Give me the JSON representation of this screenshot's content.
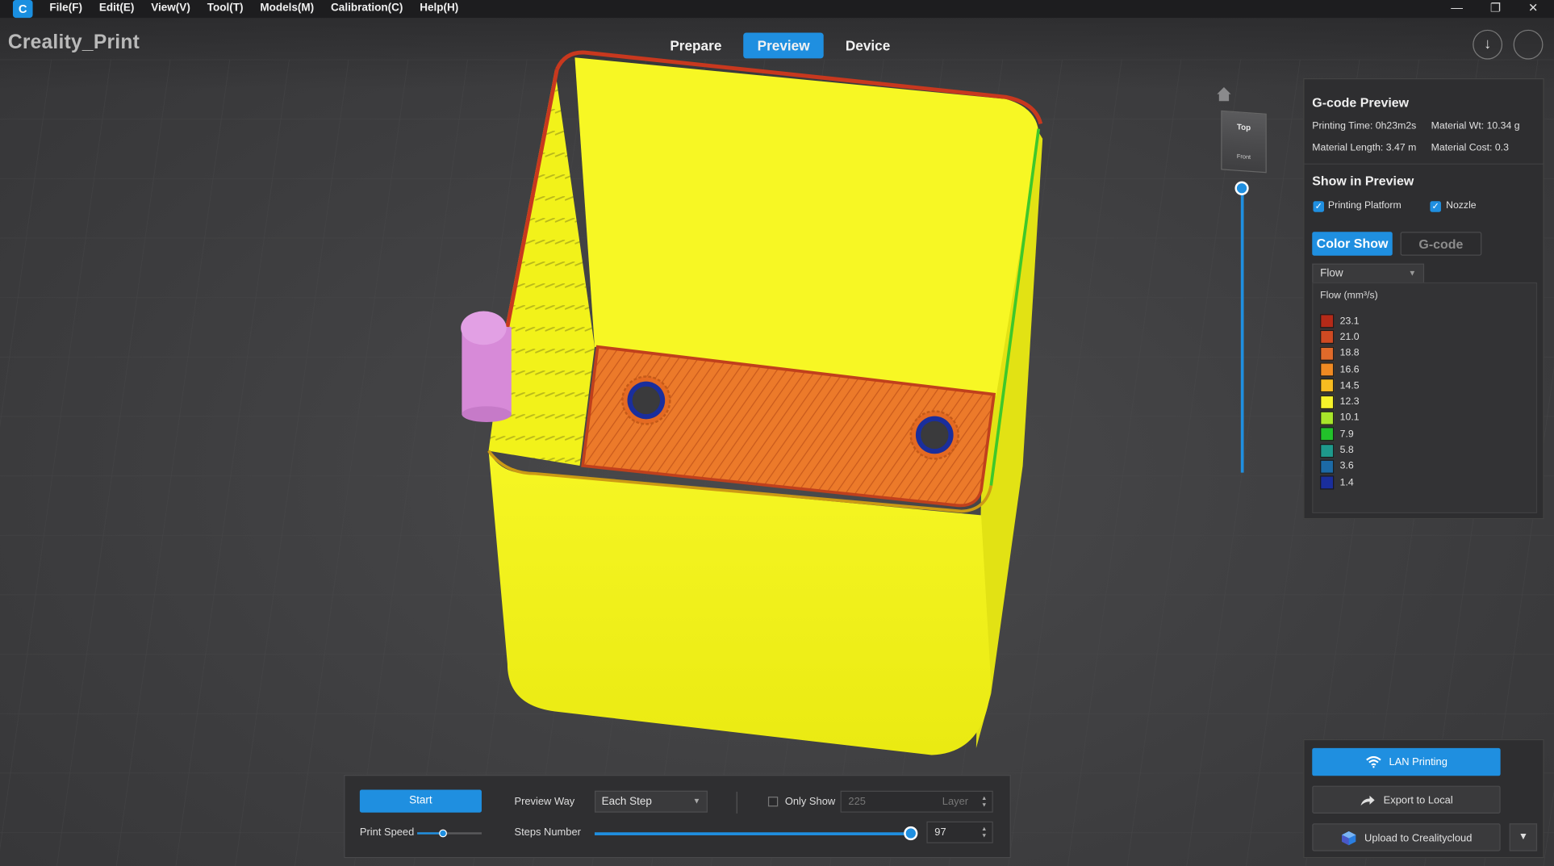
{
  "window": {
    "app_title": "Creality_Print",
    "controls": {
      "minimize": "—",
      "restore": "❐",
      "close": "✕"
    }
  },
  "menu": [
    "File(F)",
    "Edit(E)",
    "View(V)",
    "Tool(T)",
    "Models(M)",
    "Calibration(C)",
    "Help(H)"
  ],
  "top_tabs": [
    {
      "label": "Prepare",
      "active": false
    },
    {
      "label": "Preview",
      "active": true
    },
    {
      "label": "Device",
      "active": false
    }
  ],
  "view_cube": {
    "top": "Top",
    "front": "Front"
  },
  "gcode_panel": {
    "title": "G-code Preview",
    "printing_time": "Printing Time: 0h23m2s",
    "material_wt": "Material Wt: 10.34 g",
    "material_length": "Material Length: 3.47 m",
    "material_cost": "Material Cost: 0.3",
    "show_title": "Show in Preview",
    "printing_platform": "Printing Platform",
    "nozzle": "Nozzle",
    "color_show": "Color Show",
    "gcode": "G-code",
    "select_value": "Flow",
    "legend_title": "Flow (mm³/s)",
    "legend": [
      {
        "value": "23.1",
        "color": "#b52a18"
      },
      {
        "value": "21.0",
        "color": "#d04a22"
      },
      {
        "value": "18.8",
        "color": "#e06a2a"
      },
      {
        "value": "16.6",
        "color": "#f08a22"
      },
      {
        "value": "14.5",
        "color": "#f8bc20"
      },
      {
        "value": "12.3",
        "color": "#f6f22a"
      },
      {
        "value": "10.1",
        "color": "#a8e62a"
      },
      {
        "value": "7.9",
        "color": "#22c22a"
      },
      {
        "value": "5.8",
        "color": "#1e9a8c"
      },
      {
        "value": "3.6",
        "color": "#1c6aa6"
      },
      {
        "value": "1.4",
        "color": "#1a2e9c"
      }
    ]
  },
  "bottom_bar": {
    "start": "Start",
    "print_speed": "Print Speed",
    "print_speed_level": 0.4,
    "preview_way_label": "Preview Way",
    "preview_way_value": "Each Step",
    "only_show": "Only Show",
    "layer_value": "225",
    "layer_label": "Layer",
    "steps_label": "Steps Number",
    "steps_value": "97"
  },
  "export": {
    "lan": "LAN Printing",
    "local": "Export to Local",
    "cloud": "Upload to Crealitycloud"
  },
  "colors": {
    "accent": "#1f8fe0",
    "model_yellow": "#f4f41c",
    "bottom_orange": "#e87a2a",
    "purge_tower": "#d88ad8"
  }
}
